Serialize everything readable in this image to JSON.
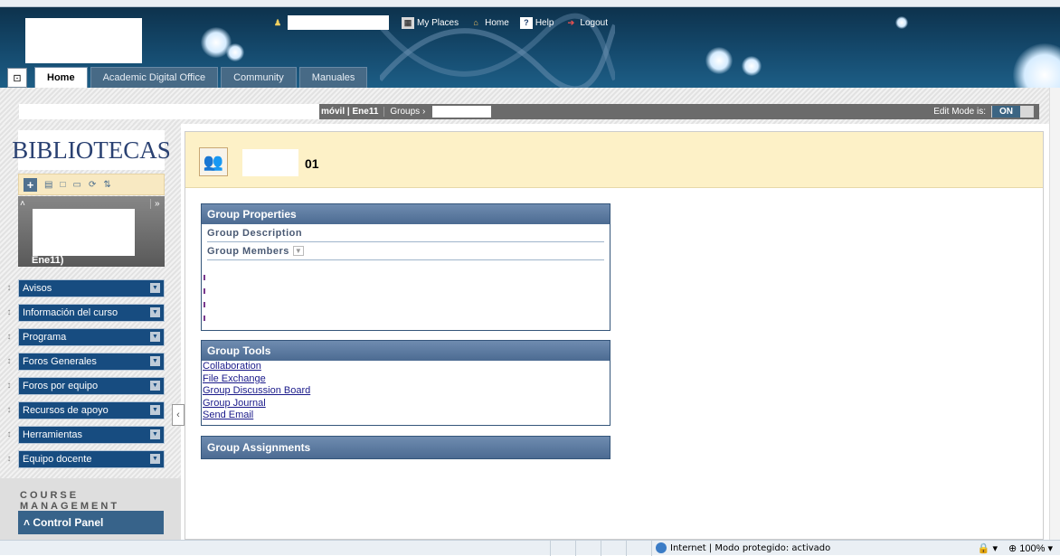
{
  "header": {
    "nav": [
      {
        "label": "My Places",
        "icon": "my-places-icon"
      },
      {
        "label": "Home",
        "icon": "home-icon"
      },
      {
        "label": "Help",
        "icon": "help-icon"
      },
      {
        "label": "Logout",
        "icon": "logout-icon"
      }
    ],
    "tabs": [
      "Home",
      "Academic Digital Office",
      "Community",
      "Manuales"
    ],
    "active_tab": "Home"
  },
  "breadcrumb": {
    "course": "móvil | Ene11",
    "groups": "Groups",
    "separator": "›",
    "edit_mode_label": "Edit Mode is:",
    "edit_mode_value": "ON"
  },
  "sidebar": {
    "library_logo": "BIBLIOTECAS",
    "course_code": "Ene11)",
    "menu_items": [
      "Avisos",
      "Información del curso",
      "Programa",
      "Foros Generales",
      "Foros por equipo",
      "Recursos de apoyo",
      "Herramientas",
      "Equipo docente"
    ],
    "course_management": "COURSE MANAGEMENT",
    "control_panel": "Control Panel"
  },
  "page": {
    "title_suffix": "01",
    "group_properties": {
      "title": "Group Properties",
      "description_label": "Group Description",
      "members_label": "Group Members"
    },
    "group_tools": {
      "title": "Group Tools",
      "links": [
        "Collaboration",
        "File Exchange",
        "Group Discussion Board",
        "Group Journal",
        "Send Email"
      ]
    },
    "group_assignments": {
      "title": "Group Assignments"
    }
  },
  "status_bar": {
    "zone": "Internet | Modo protegido: activado",
    "zoom": "100%"
  },
  "colors": {
    "header_bg": "#14486b",
    "menu_item_bg": "#174c80",
    "module_header_bg": "#4c6b92",
    "page_header_bg": "#fdf1c7"
  }
}
